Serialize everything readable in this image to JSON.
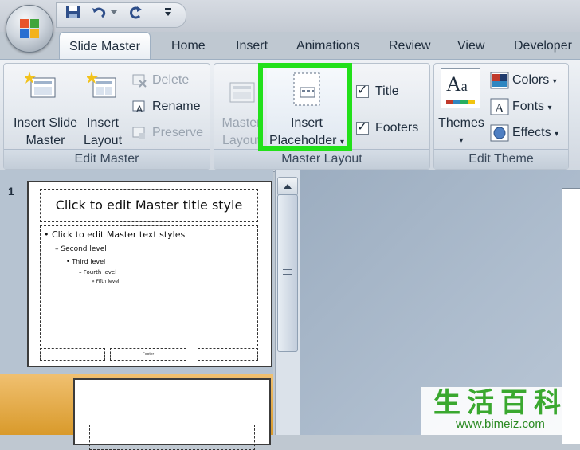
{
  "quick_access": {
    "icons": [
      "save-icon",
      "undo-icon",
      "dropdown-icon",
      "redo-icon",
      "customize-icon"
    ]
  },
  "tabs": [
    "Slide Master",
    "Home",
    "Insert",
    "Animations",
    "Review",
    "View",
    "Developer"
  ],
  "ribbon": {
    "edit_master": {
      "label": "Edit Master",
      "insert_slide_master": [
        "Insert Slide",
        "Master"
      ],
      "insert_layout": [
        "Insert",
        "Layout"
      ],
      "delete": "Delete",
      "rename": "Rename",
      "preserve": "Preserve"
    },
    "master_layout": {
      "label": "Master Layout",
      "master_layout_btn": [
        "Master",
        "Layout"
      ],
      "insert_placeholder": [
        "Insert",
        "Placeholder"
      ],
      "title": "Title",
      "footers": "Footers"
    },
    "edit_theme": {
      "label": "Edit Theme",
      "themes": "Themes",
      "colors": "Colors",
      "fonts": "Fonts",
      "effects": "Effects"
    }
  },
  "thumbnails": {
    "slide_number": "1",
    "title": "Click to edit Master title style",
    "body": [
      "Click to edit Master text styles",
      "Second level",
      "Third level",
      "Fourth level",
      "Fifth level"
    ],
    "footer_center": "Footer"
  },
  "watermark": {
    "chinese": "生活百科",
    "url": "www.bimeiz.com"
  },
  "colors": {
    "highlight": "#22e01a",
    "accent": "#1f2d3d"
  }
}
